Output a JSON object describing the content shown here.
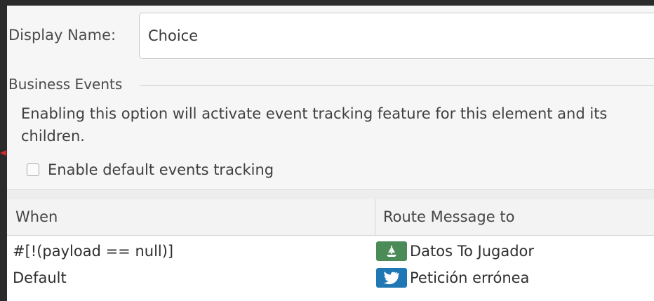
{
  "form": {
    "display_name_label": "Display Name:",
    "display_name_value": "Choice"
  },
  "business_events": {
    "title": "Business Events",
    "description": "Enabling this option will activate event tracking feature for this element and its children.",
    "checkbox_label": "Enable default events tracking",
    "checkbox_checked": false
  },
  "table": {
    "headers": {
      "when": "When",
      "route": "Route Message to"
    },
    "rows": [
      {
        "when": "#[!(payload  == null)]",
        "route": "Datos To Jugador",
        "icon": "flow-ref-icon",
        "icon_color": "#4b8b57"
      },
      {
        "when": "Default",
        "route": "Petición errónea",
        "icon": "logger-bird-icon",
        "icon_color": "#1f77b4"
      }
    ]
  },
  "colors": {
    "background": "#2b2b2b",
    "panel": "#f6f6f6",
    "accent_edge": "#d62b2b"
  }
}
